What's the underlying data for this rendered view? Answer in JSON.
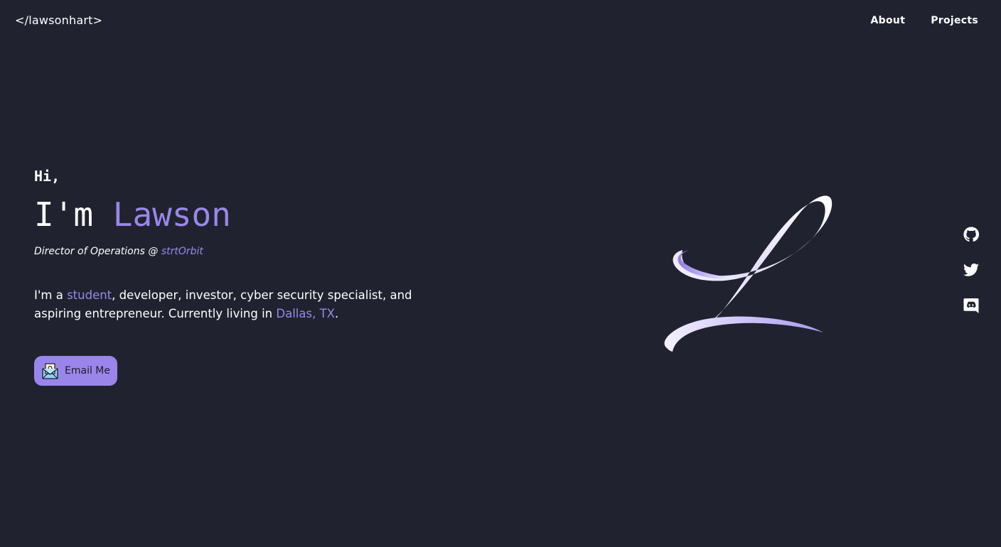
{
  "brand": {
    "logo_text": "</lawsonhart>"
  },
  "nav": {
    "items": [
      {
        "label": "About"
      },
      {
        "label": "Projects"
      }
    ]
  },
  "hero": {
    "greeting": "Hi,",
    "headline_lead": "I'm ",
    "name": "Lawson",
    "role_prefix": "Director of Operations @ ",
    "role_org": "strtOrbit",
    "bio": {
      "part1": "I'm a ",
      "highlight1": "student",
      "part2": ", developer, investor, cyber security specialist, and aspiring entrepreneur. Currently living in ",
      "highlight2": "Dallas, TX",
      "part3": "."
    },
    "email_button_label": "Email Me"
  },
  "social": [
    {
      "icon": "github-icon"
    },
    {
      "icon": "twitter-icon"
    },
    {
      "icon": "discord-icon"
    }
  ],
  "colors": {
    "background": "#20232f",
    "accent": "#9a86ea",
    "text": "#ffffff"
  }
}
